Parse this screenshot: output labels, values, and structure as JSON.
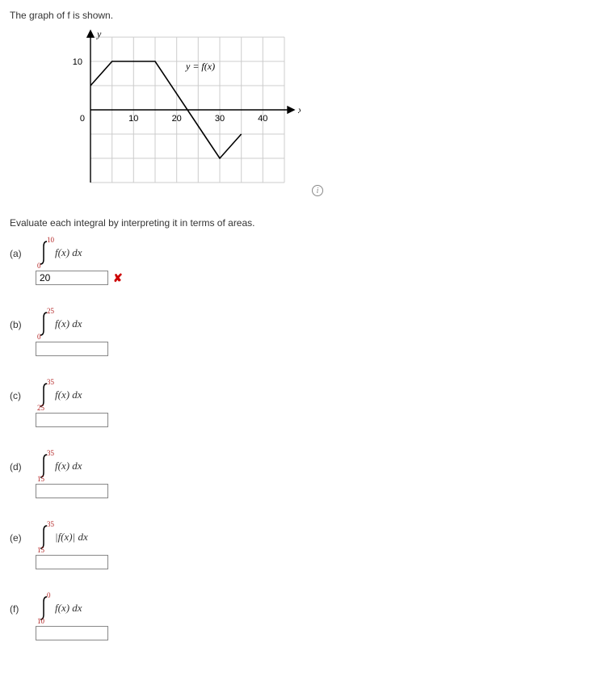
{
  "title": "The graph of f is shown.",
  "instruction": "Evaluate each integral by interpreting it in terms of areas.",
  "axis": {
    "x_label": "x",
    "y_label": "y",
    "curve_label": "y = f(x)"
  },
  "ticks": {
    "x": [
      "0",
      "10",
      "20",
      "30",
      "40"
    ],
    "y": [
      "10"
    ]
  },
  "info_badge": "i",
  "parts": {
    "a": {
      "label": "(a)",
      "upper": "10",
      "lower": "0",
      "integrand": "f(x) dx",
      "value": "20",
      "wrong": "✘"
    },
    "b": {
      "label": "(b)",
      "upper": "25",
      "lower": "0",
      "integrand": "f(x) dx",
      "value": ""
    },
    "c": {
      "label": "(c)",
      "upper": "35",
      "lower": "25",
      "integrand": "f(x) dx",
      "value": ""
    },
    "d": {
      "label": "(d)",
      "upper": "35",
      "lower": "15",
      "integrand": "f(x) dx",
      "value": ""
    },
    "e": {
      "label": "(e)",
      "upper": "35",
      "lower": "15",
      "integrand": "|f(x)| dx",
      "value": ""
    },
    "f": {
      "label": "(f)",
      "upper": "0",
      "lower": "10",
      "integrand": "f(x) dx",
      "value": ""
    }
  },
  "chart_data": {
    "type": "line",
    "title": "",
    "xlabel": "x",
    "ylabel": "y",
    "xlim": [
      -5,
      45
    ],
    "ylim": [
      -15,
      15
    ],
    "x_ticks": [
      0,
      10,
      20,
      30,
      40
    ],
    "y_ticks": [
      10
    ],
    "series": [
      {
        "name": "y = f(x)",
        "x": [
          0,
          5,
          15,
          30,
          35
        ],
        "y": [
          5,
          10,
          10,
          -10,
          -5
        ]
      }
    ]
  }
}
